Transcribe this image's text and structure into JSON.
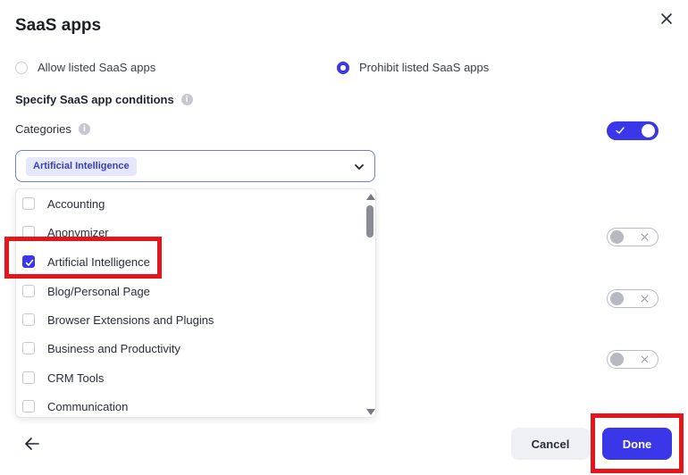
{
  "dialog": {
    "title": "SaaS apps",
    "close_icon": "close-icon"
  },
  "mode": {
    "allow_label": "Allow listed SaaS apps",
    "prohibit_label": "Prohibit listed SaaS apps",
    "selected": "prohibit"
  },
  "conditions": {
    "label": "Specify SaaS app conditions",
    "info_icon": "info-icon"
  },
  "categories": {
    "label": "Categories",
    "info_icon": "info-icon",
    "toggle_on": true,
    "selected_chip": "Artificial Intelligence",
    "options": [
      {
        "label": "Accounting",
        "checked": false
      },
      {
        "label": "Anonymizer",
        "checked": false
      },
      {
        "label": "Artificial Intelligence",
        "checked": true
      },
      {
        "label": "Blog/Personal Page",
        "checked": false
      },
      {
        "label": "Browser Extensions and Plugins",
        "checked": false
      },
      {
        "label": "Business and Productivity",
        "checked": false
      },
      {
        "label": "CRM Tools",
        "checked": false
      },
      {
        "label": "Communication",
        "checked": false
      }
    ]
  },
  "other_toggles": [
    {
      "on": false
    },
    {
      "on": false
    },
    {
      "on": false
    }
  ],
  "footer": {
    "back_icon": "arrow-left-icon",
    "cancel_label": "Cancel",
    "done_label": "Done"
  },
  "colors": {
    "accent": "#3a37e8",
    "highlight": "#e4151b"
  }
}
